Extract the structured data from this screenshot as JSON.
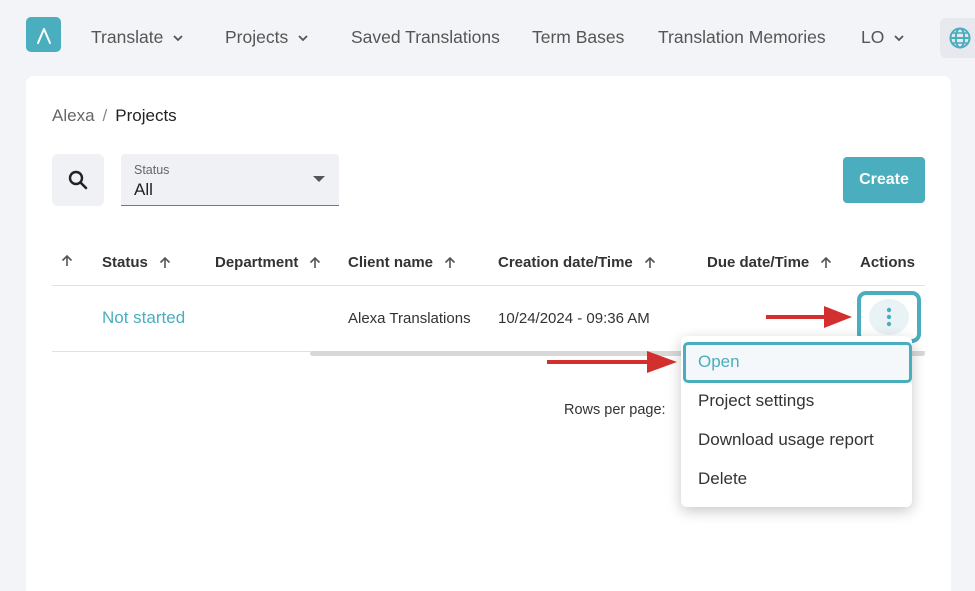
{
  "nav": {
    "items": [
      {
        "label": "Translate",
        "has_dropdown": true
      },
      {
        "label": "Projects",
        "has_dropdown": true
      },
      {
        "label": "Saved Translations",
        "has_dropdown": false
      },
      {
        "label": "Term Bases",
        "has_dropdown": false
      },
      {
        "label": "Translation Memories",
        "has_dropdown": false
      },
      {
        "label": "LO",
        "has_dropdown": true
      }
    ]
  },
  "breadcrumb": {
    "parent": "Alexa",
    "separator": "/",
    "current": "Projects"
  },
  "filters": {
    "status_label": "Status",
    "status_value": "All"
  },
  "toolbar": {
    "create_label": "Create"
  },
  "table": {
    "columns": [
      "Status",
      "Department",
      "Client name",
      "Creation date/Time",
      "Due date/Time",
      "Actions"
    ],
    "rows": [
      {
        "status": "Not started",
        "department": "",
        "client_name": "Alexa Translations",
        "creation": "10/24/2024 - 09:36 AM",
        "due": ""
      }
    ]
  },
  "pagination": {
    "rows_per_page_label": "Rows per page:"
  },
  "menu": {
    "items": [
      "Open",
      "Project settings",
      "Download usage report",
      "Delete"
    ]
  },
  "colors": {
    "accent": "#4aaebe",
    "arrow": "#d32f2f"
  },
  "icons": {
    "logo": "lambda-logo-icon",
    "globe": "globe-icon",
    "search": "search-icon",
    "sort": "arrow-up-icon",
    "more": "more-vertical-icon"
  }
}
